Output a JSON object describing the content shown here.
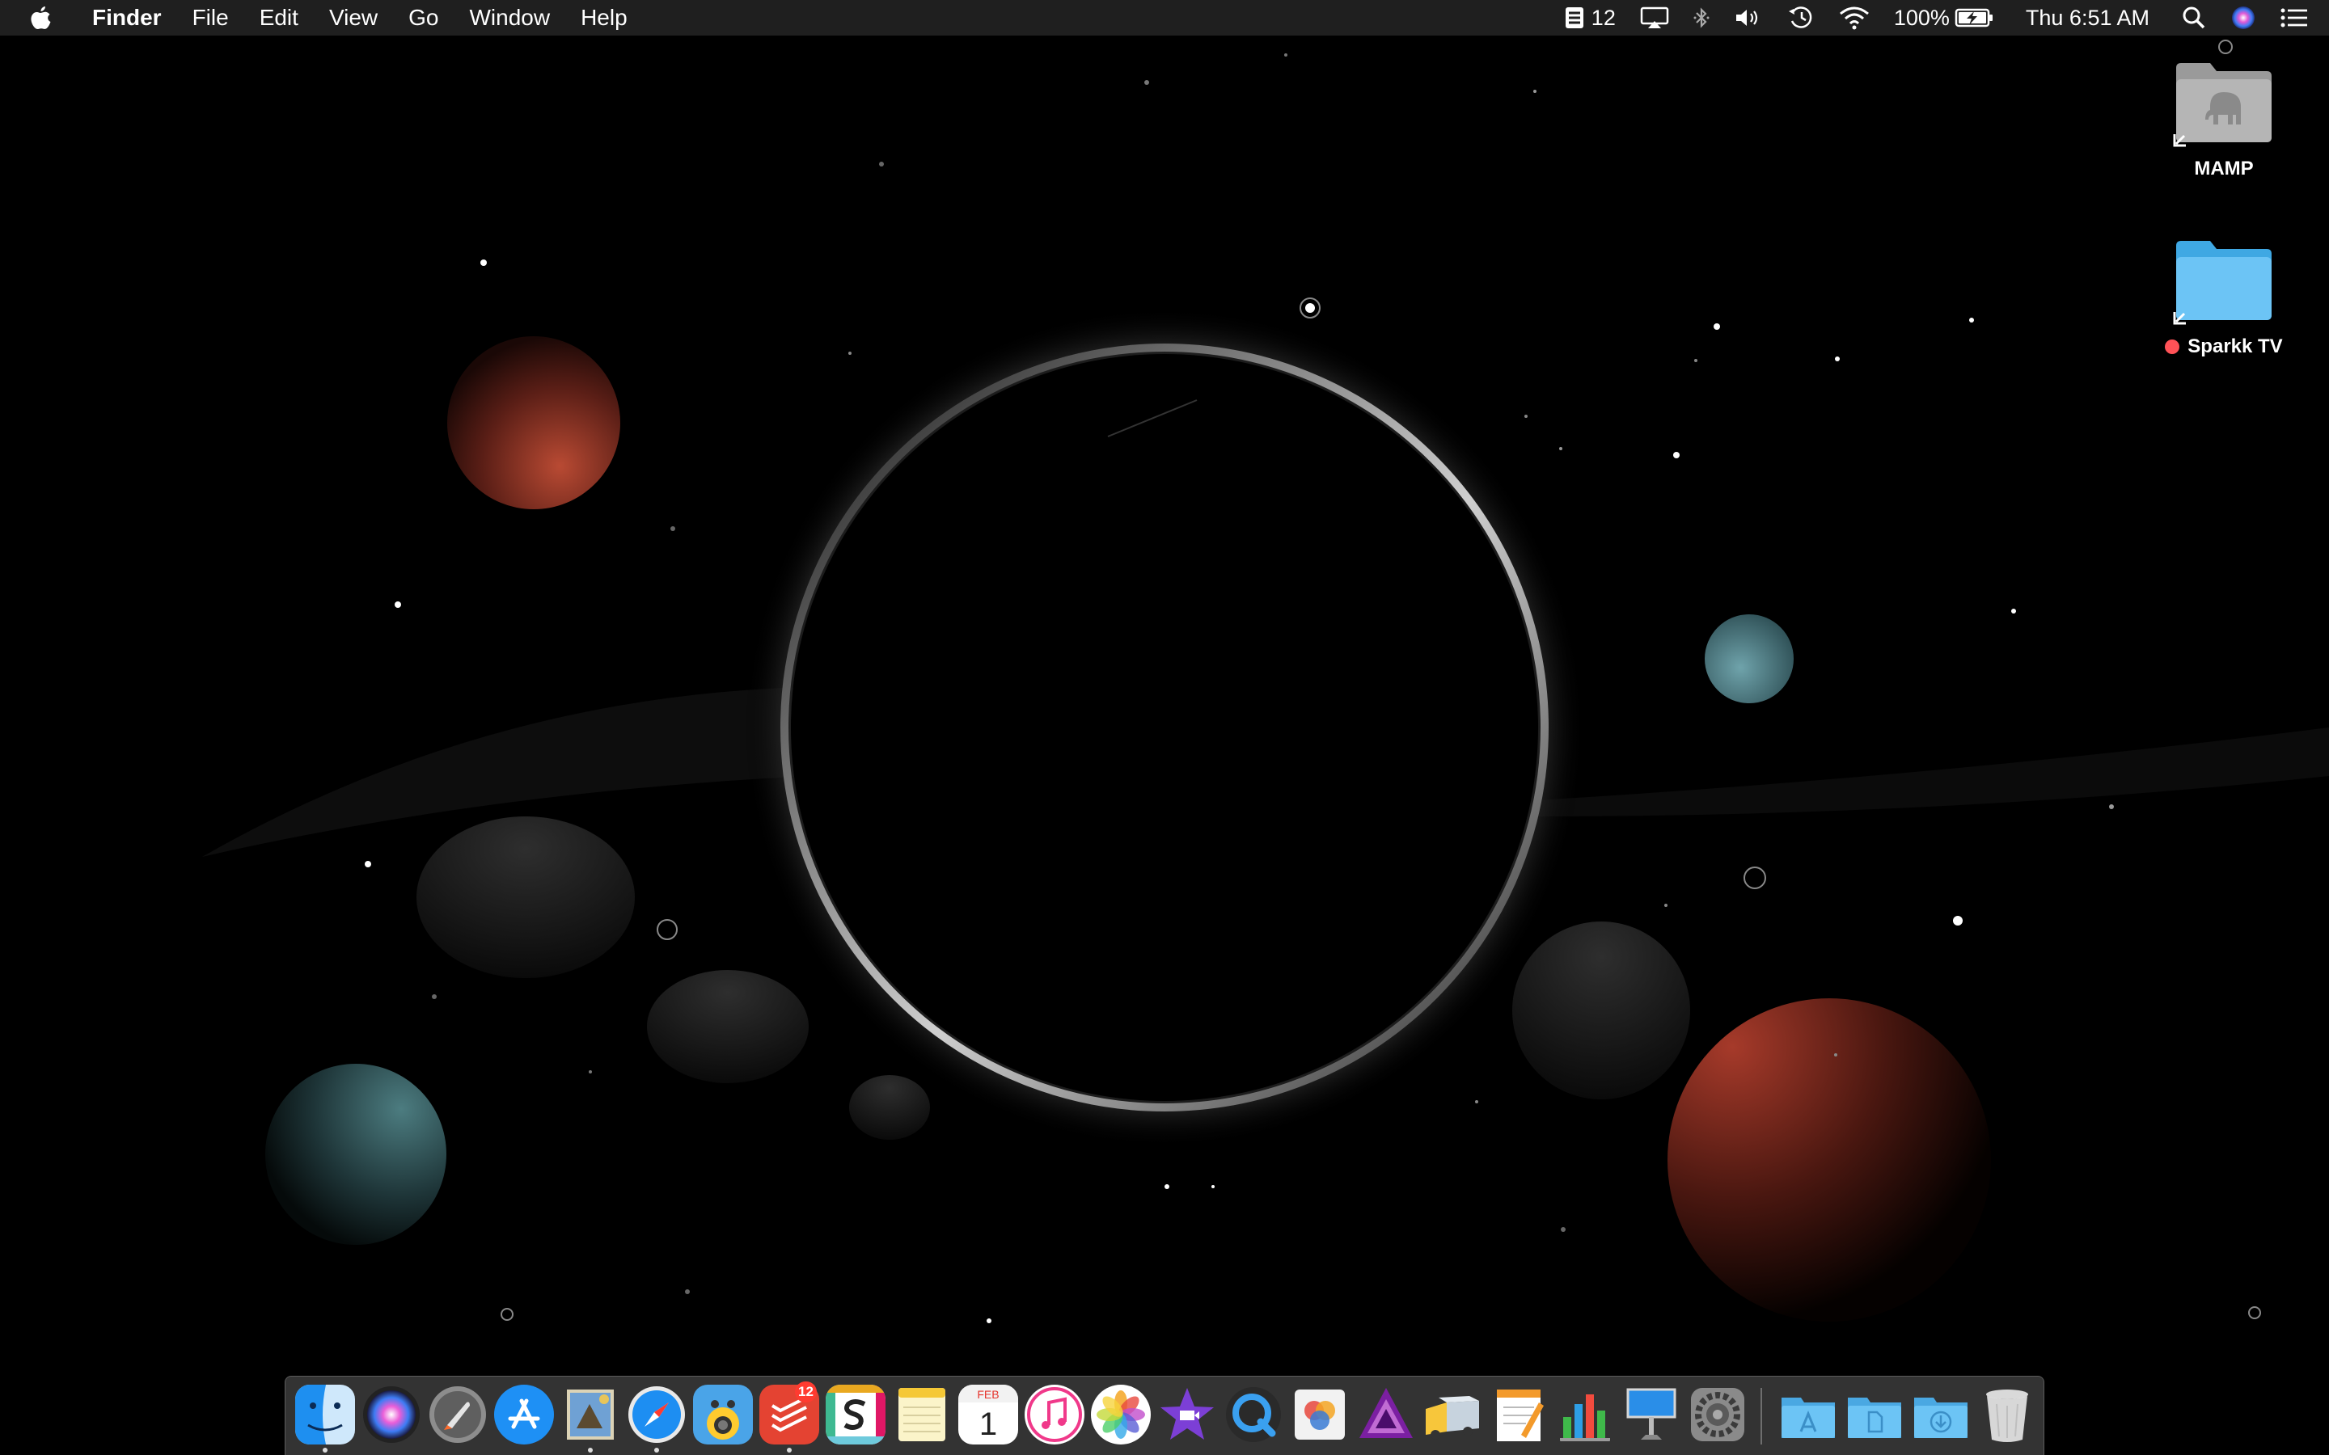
{
  "menubar": {
    "app_name": "Finder",
    "menus": [
      "File",
      "Edit",
      "View",
      "Go",
      "Window",
      "Help"
    ],
    "status": {
      "todo_count": "12",
      "battery": "100%",
      "clock": "Thu 6:51 AM"
    }
  },
  "desktop": {
    "icons": [
      {
        "label": "MAMP",
        "icon": "mamp-folder-icon"
      },
      {
        "label": "Sparkk TV",
        "icon": "folder-icon",
        "tag_color": "#ff5257"
      }
    ]
  },
  "dock": {
    "apps": [
      {
        "name": "Finder",
        "icon": "finder-icon",
        "running": true
      },
      {
        "name": "Siri",
        "icon": "siri-icon"
      },
      {
        "name": "Launchpad",
        "icon": "launchpad-icon"
      },
      {
        "name": "App Store",
        "icon": "app-store-icon"
      },
      {
        "name": "Mail",
        "icon": "mail-icon",
        "running": true
      },
      {
        "name": "Safari",
        "icon": "safari-icon",
        "running": true
      },
      {
        "name": "Tweetbot",
        "icon": "tweetbot-icon"
      },
      {
        "name": "Todoist",
        "icon": "todoist-icon",
        "badge": "12",
        "running": true
      },
      {
        "name": "Slack",
        "icon": "slack-icon"
      },
      {
        "name": "Notes",
        "icon": "notes-icon"
      },
      {
        "name": "Calendar",
        "icon": "calendar-icon",
        "month": "FEB",
        "day": "1"
      },
      {
        "name": "iTunes",
        "icon": "itunes-icon"
      },
      {
        "name": "Photos",
        "icon": "photos-icon"
      },
      {
        "name": "iMovie",
        "icon": "imovie-icon"
      },
      {
        "name": "QuickTime Player",
        "icon": "quicktime-icon"
      },
      {
        "name": "Pixelmator",
        "icon": "pixelmator-icon"
      },
      {
        "name": "Affinity Photo",
        "icon": "affinity-photo-icon"
      },
      {
        "name": "Transmit",
        "icon": "transmit-icon"
      },
      {
        "name": "Pages",
        "icon": "pages-icon"
      },
      {
        "name": "Numbers",
        "icon": "numbers-icon"
      },
      {
        "name": "Keynote",
        "icon": "keynote-icon"
      },
      {
        "name": "System Preferences",
        "icon": "system-preferences-icon"
      }
    ],
    "stacks": [
      {
        "name": "Applications",
        "icon": "applications-folder-icon"
      },
      {
        "name": "Documents",
        "icon": "documents-folder-icon"
      },
      {
        "name": "Downloads",
        "icon": "downloads-folder-icon"
      },
      {
        "name": "Trash",
        "icon": "trash-icon"
      }
    ]
  },
  "colors": {
    "menubar_bg": "#1f1f1f",
    "folder_blue": "#6cc4f5",
    "badge_red": "#ff3b30"
  }
}
